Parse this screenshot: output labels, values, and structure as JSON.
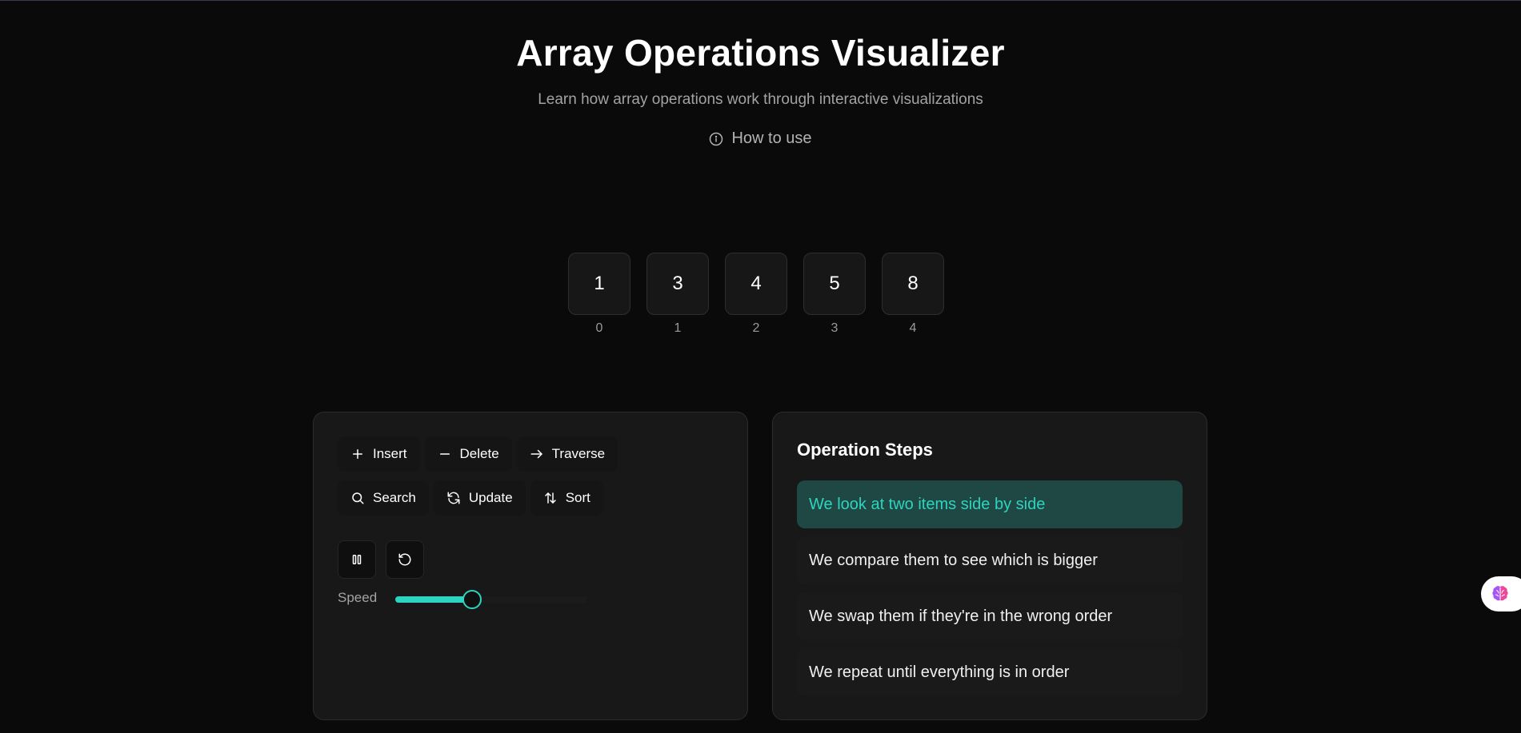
{
  "header": {
    "title": "Array Operations Visualizer",
    "subtitle": "Learn how array operations work through interactive visualizations",
    "how_to_use": "How to use"
  },
  "array": {
    "values": [
      "1",
      "3",
      "4",
      "5",
      "8"
    ],
    "indices": [
      "0",
      "1",
      "2",
      "3",
      "4"
    ]
  },
  "operations": {
    "insert": "Insert",
    "delete": "Delete",
    "traverse": "Traverse",
    "search": "Search",
    "update": "Update",
    "sort": "Sort"
  },
  "controls": {
    "speed_label": "Speed",
    "speed_fraction": 0.4
  },
  "steps_panel": {
    "title": "Operation Steps",
    "steps": [
      "We look at two items side by side",
      "We compare them to see which is bigger",
      "We swap them if they're in the wrong order",
      "We repeat until everything is in order"
    ],
    "active_index": 0
  },
  "colors": {
    "accent": "#2dd4bf",
    "background": "#0a0a0a",
    "panel": "#181818",
    "active_step_bg": "#1f4743"
  }
}
